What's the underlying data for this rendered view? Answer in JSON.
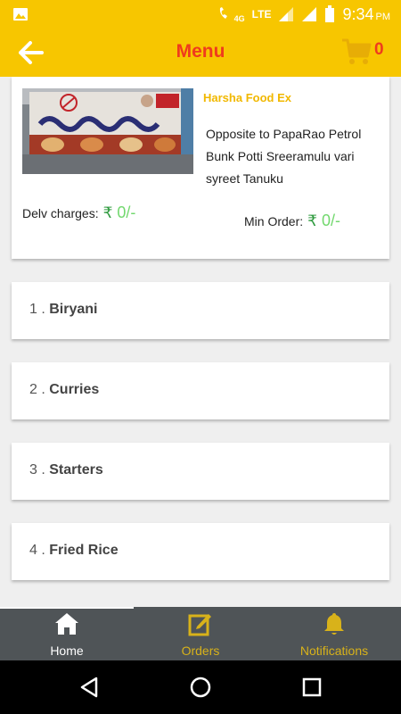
{
  "status_bar": {
    "time": "9:34",
    "ampm": "PM",
    "network": "LTE",
    "call_label": "4G",
    "icons": [
      "gallery-icon",
      "call-4g-icon",
      "signal-icon",
      "signal-icon",
      "battery-icon"
    ]
  },
  "app_bar": {
    "title": "Menu",
    "cart_count": "0",
    "icons": [
      "back-arrow-icon",
      "cart-icon"
    ]
  },
  "restaurant": {
    "name": "Harsha Food Ex",
    "address": "Opposite to PapaRao Petrol Bunk Potti Sreeramulu vari syreet Tanuku",
    "delivery_label": "Delv charges:",
    "delivery_amount": "0/-",
    "min_order_label": "Min Order:",
    "min_order_amount": "0/-",
    "currency_symbol": "₹"
  },
  "categories": [
    {
      "number": "1 . ",
      "name": "Biryani"
    },
    {
      "number": "2 . ",
      "name": "Curries"
    },
    {
      "number": "3 . ",
      "name": "Starters"
    },
    {
      "number": "4 . ",
      "name": "Fried Rice"
    }
  ],
  "bottom_nav": {
    "items": [
      {
        "label": "Home",
        "icon": "home-icon",
        "active": true
      },
      {
        "label": "Orders",
        "icon": "edit-icon",
        "active": false
      },
      {
        "label": "Notifications",
        "icon": "bell-icon",
        "active": false
      }
    ]
  },
  "colors": {
    "app_bar": "#f7c600",
    "title": "#ef3b1d",
    "restaurant_name": "#f1b800",
    "rupee": "#2e9a3e",
    "amount": "#72d86e",
    "bottom_nav": "#4f5457",
    "inactive_nav": "#d8b21a"
  }
}
